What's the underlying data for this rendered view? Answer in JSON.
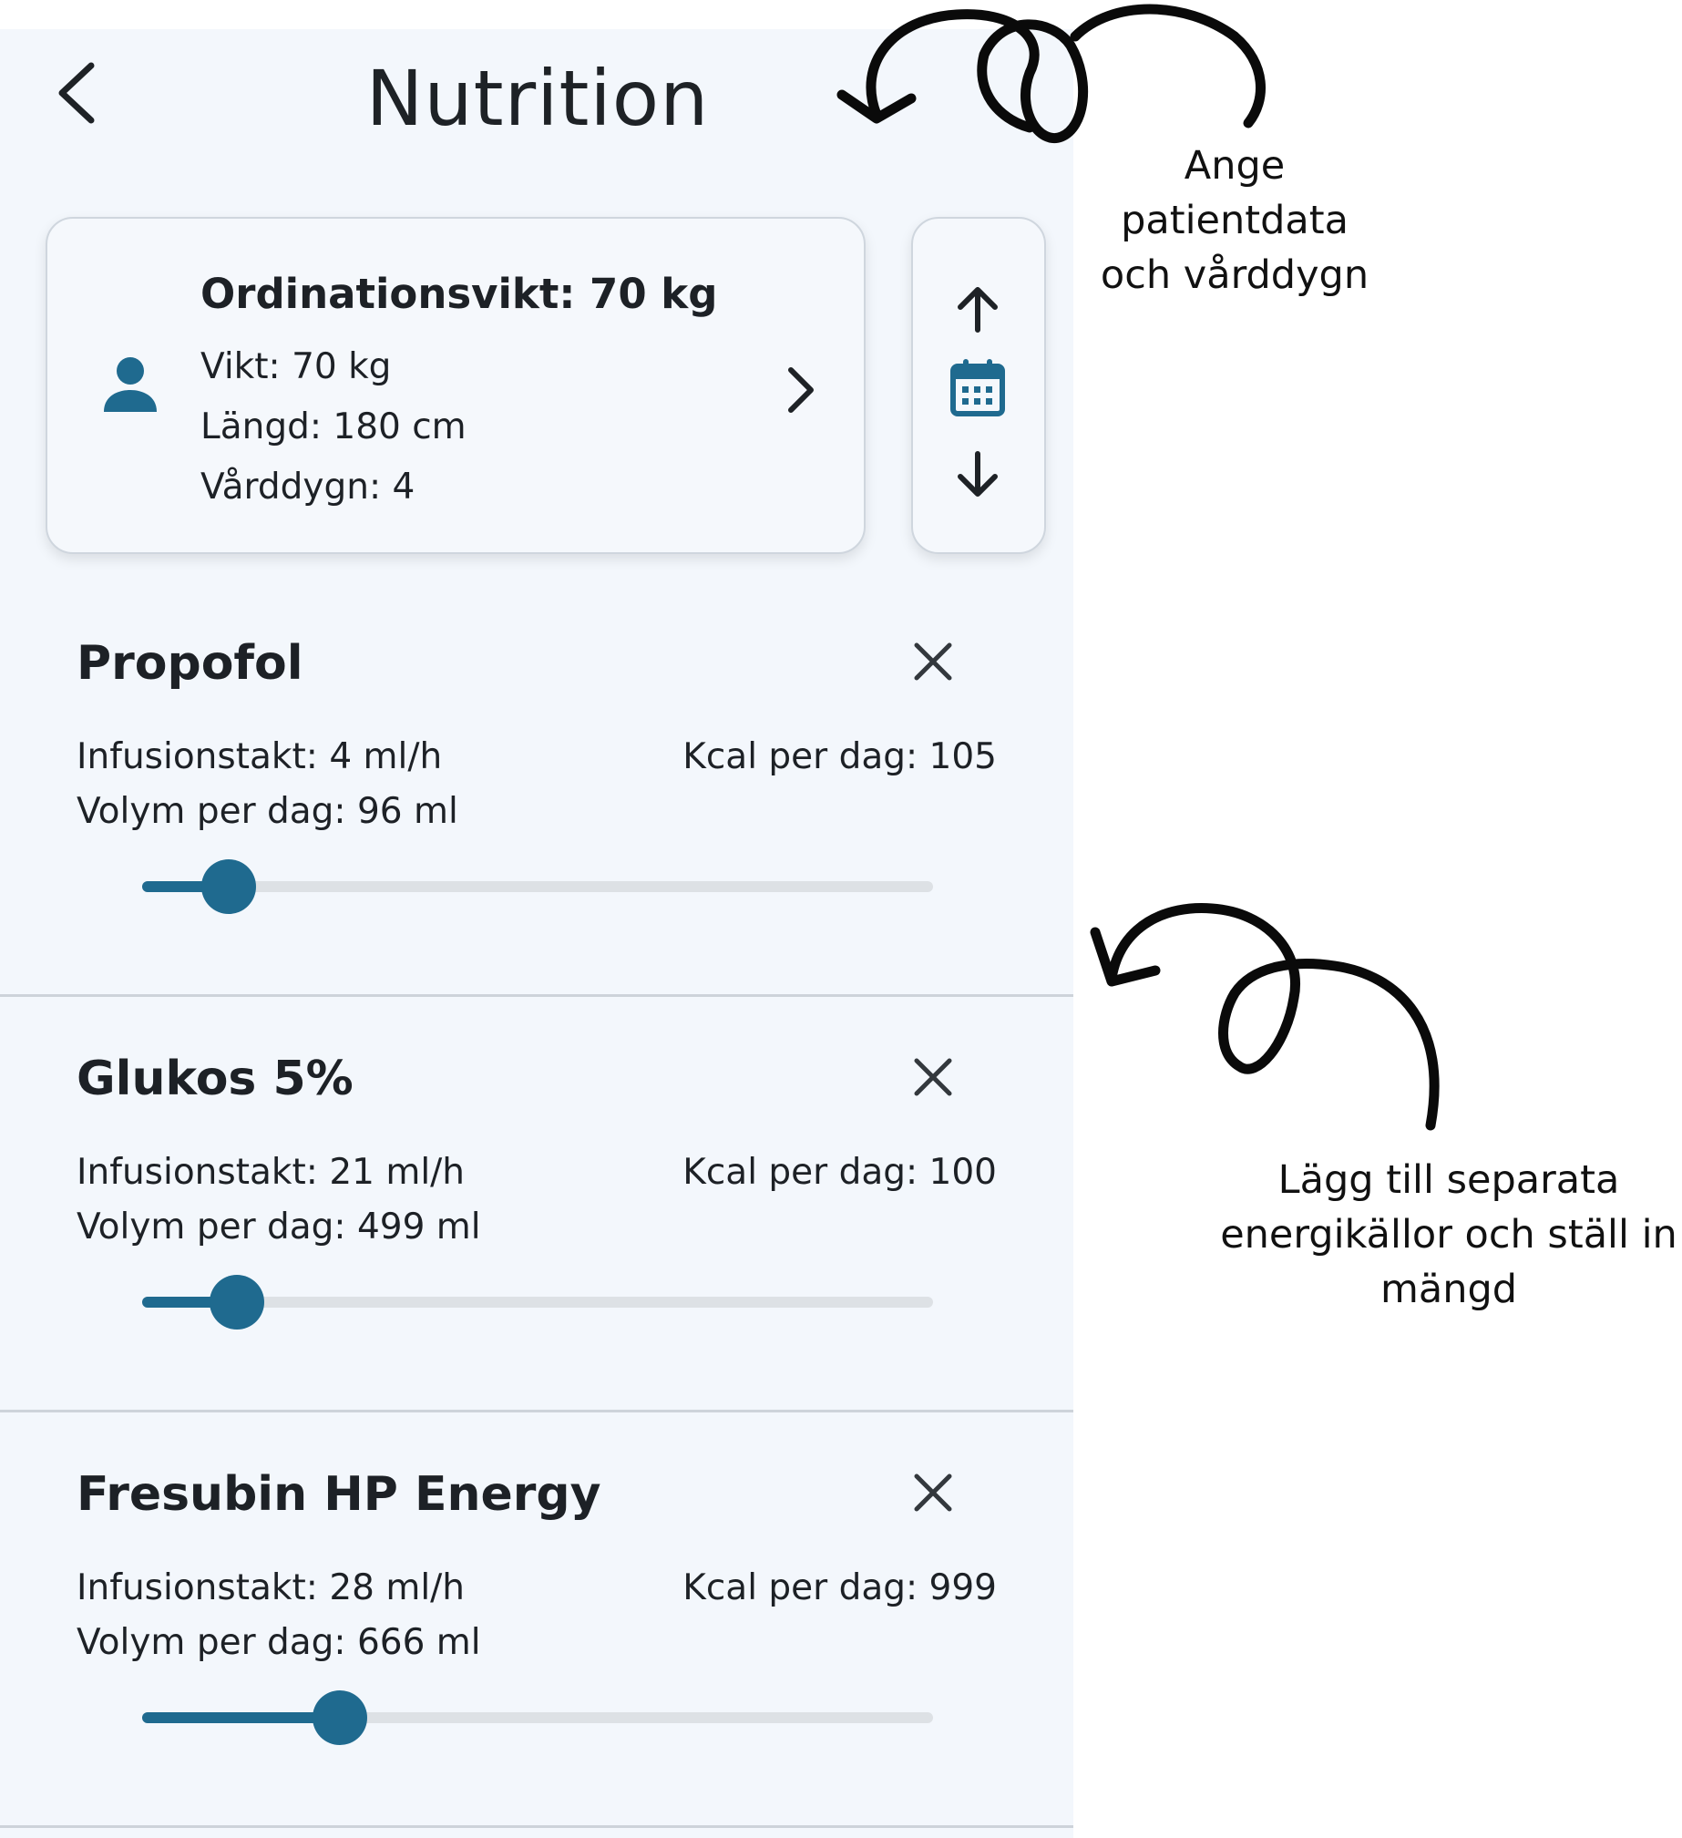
{
  "header": {
    "title": "Nutrition"
  },
  "patient_card": {
    "heading": "Ordinationsvikt: 70 kg",
    "weight": "Vikt: 70 kg",
    "height": "Längd: 180 cm",
    "care_day": "Vårddygn: 4"
  },
  "icons": {
    "back": "chevron-left-icon",
    "person": "person-icon",
    "open": "chevron-right-icon",
    "up": "arrow-up-icon",
    "calendar": "calendar-icon",
    "down": "arrow-down-icon",
    "close": "close-icon"
  },
  "colors": {
    "accent": "#1f6a8f",
    "background": "#f3f7fc",
    "track": "#dde1e5"
  },
  "items": [
    {
      "name": "Propofol",
      "rate": "Infusionstakt: 4 ml/h",
      "volume": "Volym per dag: 96 ml",
      "kcal": "Kcal per dag: 105",
      "slider_level": 0.11
    },
    {
      "name": "Glukos 5%",
      "rate": "Infusionstakt: 21 ml/h",
      "volume": "Volym per dag: 499 ml",
      "kcal": "Kcal per dag: 100",
      "slider_level": 0.12
    },
    {
      "name": "Fresubin HP Energy",
      "rate": "Infusionstakt: 28 ml/h",
      "volume": "Volym per dag: 666 ml",
      "kcal": "Kcal per dag: 999",
      "slider_level": 0.25
    }
  ],
  "annotations": {
    "top": [
      "Ange",
      "patientdata",
      "och vårddygn"
    ],
    "bottom": [
      "Lägg till separata",
      "energikällor och ställ in",
      "mängd"
    ]
  }
}
